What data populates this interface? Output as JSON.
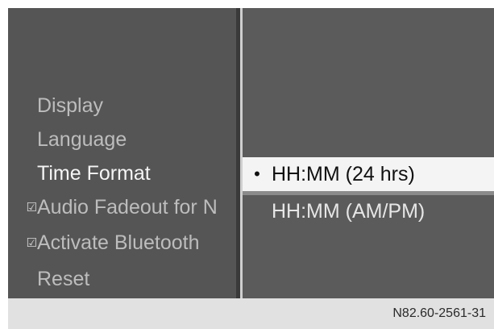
{
  "menu": {
    "items": [
      {
        "label": "Display",
        "checked": false,
        "active": false
      },
      {
        "label": "Language",
        "checked": false,
        "active": false
      },
      {
        "label": "Time Format",
        "checked": false,
        "active": true
      },
      {
        "label": "Audio Fadeout for N",
        "checked": true,
        "active": false
      },
      {
        "label": "Activate Bluetooth",
        "checked": true,
        "active": false
      },
      {
        "label": "Reset",
        "checked": false,
        "active": false
      }
    ],
    "check_glyph": "☑"
  },
  "options": {
    "bullet_glyph": "•",
    "items": [
      {
        "label": "HH:MM (24 hrs)",
        "selected": true
      },
      {
        "label": "HH:MM (AM/PM)",
        "selected": false
      }
    ]
  },
  "footer": {
    "code": "N82.60-2561-31"
  },
  "colors": {
    "menu_background": "#555555",
    "panel_background": "#5b5b5b",
    "selected_background": "#f4f4f4",
    "footer_background": "#e1e1e1"
  }
}
